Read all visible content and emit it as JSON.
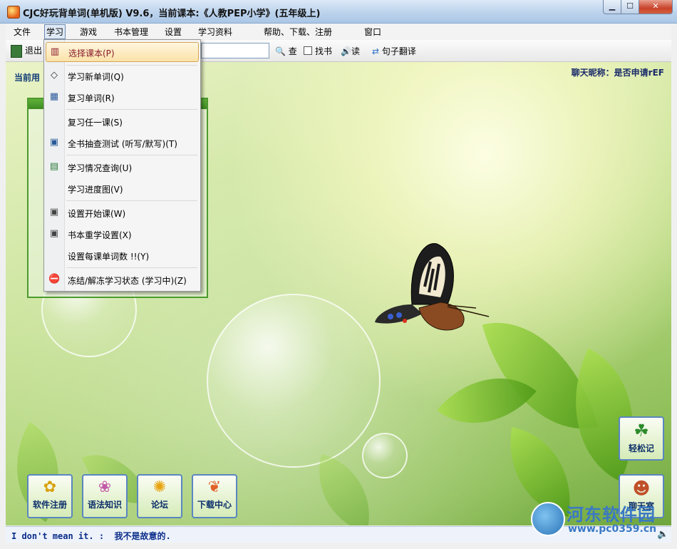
{
  "window": {
    "title": "CJC好玩背单词(单机版) V9.6，当前课本:《人教PEP小学》(五年级上)",
    "controls": {
      "minimize": "▁",
      "maximize": "☐",
      "close": "✕"
    }
  },
  "menubar": {
    "items": [
      "文件",
      "学习",
      "游戏",
      "书本管理",
      "设置",
      "学习资料",
      "帮助、下载、注册",
      "窗口"
    ],
    "active_index": 1
  },
  "toolbar": {
    "exit": "退出",
    "search_value": "",
    "query": "查",
    "find_book": "找书",
    "read": "读",
    "translate": "句子翻译"
  },
  "content": {
    "current_label": "当前用",
    "chat_nickname": "聊天昵称：是否申请rEF"
  },
  "study_menu": {
    "items": [
      {
        "label": "选择课本(P)",
        "icon": "books-icon",
        "selected": true
      },
      {
        "label": "学习新单词(Q)",
        "icon": "eraser-icon"
      },
      {
        "label": "复习单词(R)",
        "icon": "table-icon"
      },
      {
        "label": "复习任一课(S)",
        "icon": ""
      },
      {
        "label": "全书抽查测试 (听写/默写)(T)",
        "icon": "test-icon"
      },
      {
        "label": "学习情况查询(U)",
        "icon": "report-icon"
      },
      {
        "label": "学习进度图(V)",
        "icon": ""
      },
      {
        "label": "设置开始课(W)",
        "icon": "window-icon"
      },
      {
        "label": "书本重学设置(X)",
        "icon": "window-icon"
      },
      {
        "label": "设置每课单词数 !!(Y)",
        "icon": ""
      },
      {
        "label": "冻结/解冻学习状态 (学习中)(Z)",
        "icon": "stop-icon"
      }
    ]
  },
  "bottom_buttons": [
    {
      "label": "软件注册",
      "icon": "flower-icon"
    },
    {
      "label": "语法知识",
      "icon": "butterfly-icon"
    },
    {
      "label": "论坛",
      "icon": "sunflower-icon"
    },
    {
      "label": "下载中心",
      "icon": "carrot-icon"
    }
  ],
  "right_buttons": [
    {
      "label": "轻松记",
      "icon": "clover-icon"
    },
    {
      "label": "聊天室",
      "icon": "people-icon"
    }
  ],
  "status": {
    "text": "I don't mean it. :  我不是故意的."
  },
  "watermark": {
    "main": "河东软件园",
    "url": "www.pc0359.cn"
  }
}
